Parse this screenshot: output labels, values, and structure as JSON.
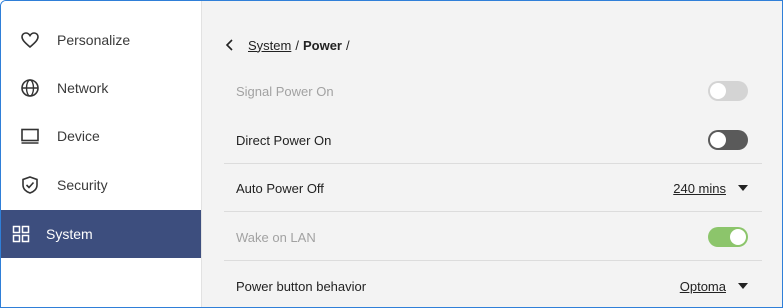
{
  "sidebar": {
    "items": [
      {
        "label": "Personalize",
        "icon": "heart-icon"
      },
      {
        "label": "Network",
        "icon": "globe-icon"
      },
      {
        "label": "Device",
        "icon": "monitor-icon"
      },
      {
        "label": "Security",
        "icon": "shield-check-icon"
      },
      {
        "label": "System",
        "icon": "grid-icon"
      }
    ],
    "active_index": 4
  },
  "breadcrumb": {
    "parent": "System",
    "separator": "/",
    "current": "Power",
    "trailing": "/"
  },
  "settings": {
    "signal_power_on": {
      "label": "Signal Power On",
      "state": "off",
      "enabled": false
    },
    "direct_power_on": {
      "label": "Direct Power On",
      "state": "off",
      "enabled": true
    },
    "auto_power_off": {
      "label": "Auto Power Off",
      "value": "240 mins"
    },
    "wake_on_lan": {
      "label": "Wake on LAN",
      "state": "on",
      "enabled": false
    },
    "power_button_behavior": {
      "label": "Power button behavior",
      "value": "Optoma"
    }
  },
  "colors": {
    "accent": "#3d4e7e",
    "toggle_on": "#8cc56b",
    "toggle_off_dark": "#5a5a5a",
    "toggle_off_disabled": "#d4d4d4",
    "frame_border": "#2f7fd8"
  }
}
